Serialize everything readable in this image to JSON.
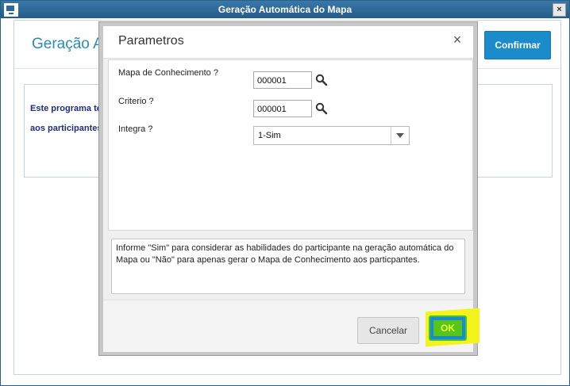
{
  "window": {
    "title": "Geração Automática do Mapa",
    "close_label": "×"
  },
  "background": {
    "title": "Geração A",
    "confirm_label": "Confirmar",
    "text_line1": "Este programa te",
    "text_line2": "aos participantes"
  },
  "dialog": {
    "title": "Parametros",
    "close_label": "×",
    "fields": [
      {
        "label": "Mapa de Conhecimento ?",
        "value": "000001"
      },
      {
        "label": "Criterio ?",
        "value": "000001"
      },
      {
        "label": "Integra ?",
        "value": "1-Sim"
      }
    ],
    "help_text": "Informe \"Sim\" para considerar as habilidades do participante na geração automática do Mapa ou \"Não\" para apenas gerar o Mapa de Conhecimento aos particpantes.",
    "cancel_label": "Cancelar",
    "ok_label": "OK"
  },
  "colors": {
    "accent": "#1a8ccc",
    "title_blue": "#2b8ab8",
    "highlight": "#f3f31e",
    "ok_green": "#58c51d"
  },
  "icons": [
    "app-icon",
    "close-icon",
    "search-icon",
    "chevron-down-icon"
  ]
}
